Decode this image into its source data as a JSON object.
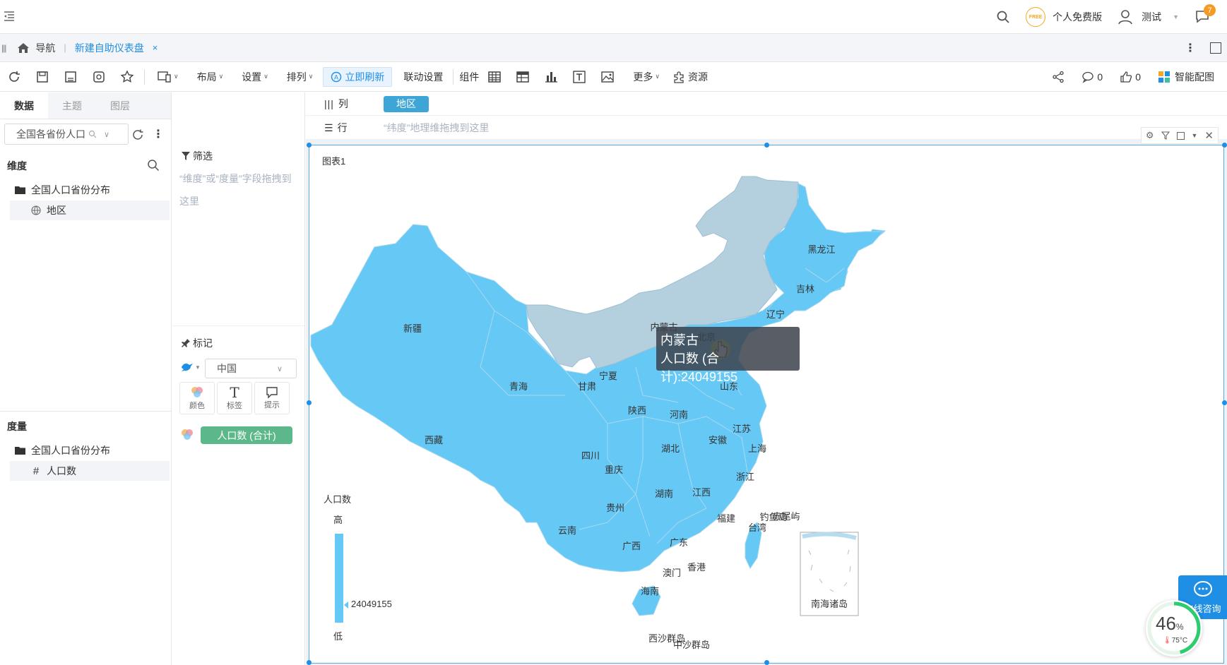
{
  "topbar": {
    "free_badge": "FREE",
    "edition": "个人免费版",
    "user": "测试",
    "notification_count": "7"
  },
  "navbar": {
    "home_label": "导航",
    "active_tab": "新建自助仪表盘",
    "close": "×"
  },
  "toolbar": {
    "layout": "布局",
    "settings": "设置",
    "arrange": "排列",
    "refresh": "立即刷新",
    "linkage": "联动设置",
    "component": "组件",
    "more": "更多",
    "resource": "资源",
    "comment_count": "0",
    "like_count": "0",
    "smart_config": "智能配图"
  },
  "left_panel": {
    "tabs": [
      "数据",
      "主题",
      "图层"
    ],
    "datasource": "全国各省份人口",
    "dimension_title": "维度",
    "dimension_folder": "全国人口省份分布",
    "dimension_field": "地区",
    "measure_title": "度量",
    "measure_folder": "全国人口省份分布",
    "measure_field": "人口数"
  },
  "mid_panel": {
    "filter_label": "筛选",
    "filter_hint": "“维度”或“度量”字段拖拽到这里",
    "mark_label": "标记",
    "map_select": "中国",
    "color_btn": "颜色",
    "label_btn": "标签",
    "tooltip_btn": "提示",
    "measure_pill": "人口数 (合计)"
  },
  "shelves": {
    "column_label": "列",
    "column_pill": "地区",
    "row_label": "行",
    "row_hint": "“纬度”地理维拖拽到这里"
  },
  "chart": {
    "title": "图表1",
    "legend_title": "人口数",
    "legend_high": "高",
    "legend_low": "低",
    "legend_value": "24049155",
    "tooltip_region": "内蒙古",
    "tooltip_value": "人口数 (合计):24049155",
    "highlight_color": "#b4cfdd",
    "fill_color": "#66c8f5",
    "south_sea_label": "南海诸岛",
    "province_labels": [
      {
        "name": "黑龙江"
      },
      {
        "name": "吉林"
      },
      {
        "name": "辽宁"
      },
      {
        "name": "新疆"
      },
      {
        "name": "内蒙古"
      },
      {
        "name": "北京"
      },
      {
        "name": "宁夏"
      },
      {
        "name": "青海"
      },
      {
        "name": "甘肃"
      },
      {
        "name": "山东"
      },
      {
        "name": "陕西"
      },
      {
        "name": "河南"
      },
      {
        "name": "江苏"
      },
      {
        "name": "西藏"
      },
      {
        "name": "安徽"
      },
      {
        "name": "上海"
      },
      {
        "name": "湖北"
      },
      {
        "name": "四川"
      },
      {
        "name": "重庆"
      },
      {
        "name": "浙江"
      },
      {
        "name": "湖南"
      },
      {
        "name": "江西"
      },
      {
        "name": "贵州"
      },
      {
        "name": "福建"
      },
      {
        "name": "钓鱼岛"
      },
      {
        "name": "赤尾屿"
      },
      {
        "name": "台湾"
      },
      {
        "name": "云南"
      },
      {
        "name": "广西"
      },
      {
        "name": "广东"
      },
      {
        "name": "香港"
      },
      {
        "name": "澳门"
      },
      {
        "name": "海南"
      },
      {
        "name": "西沙群岛"
      },
      {
        "name": "中沙群岛"
      }
    ]
  },
  "widgets": {
    "consult_label": "在线咨询",
    "gauge_percent": "46",
    "gauge_unit": "%",
    "gauge_temp": "75°C"
  }
}
